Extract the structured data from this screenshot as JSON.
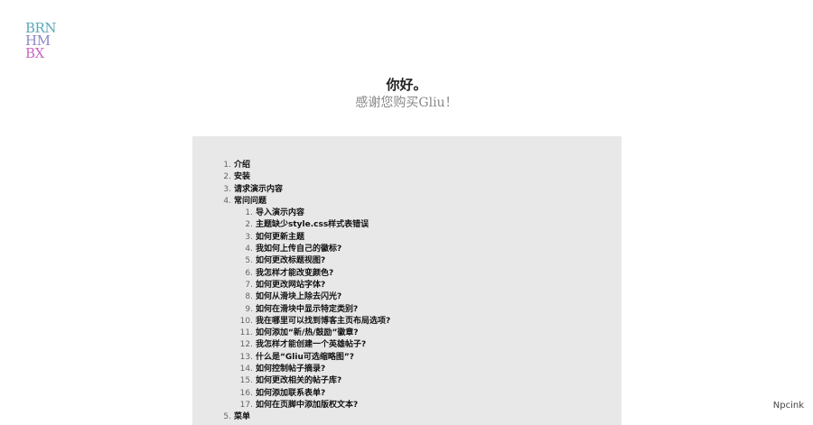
{
  "logo": {
    "line1": "BRN",
    "line2": "HM",
    "line3": "BX"
  },
  "greeting": {
    "hello": "你好。",
    "thanks": "感谢您购买Gliu！"
  },
  "toc": {
    "top": [
      {
        "num": "1.",
        "label": "介绍"
      },
      {
        "num": "2.",
        "label": "安装"
      },
      {
        "num": "3.",
        "label": "请求演示内容"
      },
      {
        "num": "4.",
        "label": "常问问题"
      }
    ],
    "faq": [
      {
        "num": "1.",
        "label": "导入演示内容"
      },
      {
        "num": "2.",
        "label": "主题缺少style.css样式表错误"
      },
      {
        "num": "3.",
        "label": "如何更新主题"
      },
      {
        "num": "4.",
        "label": "我如何上传自己的徽标?"
      },
      {
        "num": "5.",
        "label": "如何更改标题视图?"
      },
      {
        "num": "6.",
        "label": "我怎样才能改变颜色?"
      },
      {
        "num": "7.",
        "label": "如何更改网站字体?"
      },
      {
        "num": "8.",
        "label": "如何从滑块上除去闪光?"
      },
      {
        "num": "9.",
        "label": "如何在滑块中显示特定类别?"
      },
      {
        "num": "10.",
        "label": "我在哪里可以找到博客主页布局选项?"
      },
      {
        "num": "11.",
        "label": "如何添加“新/热/鼓励”徽章?"
      },
      {
        "num": "12.",
        "label": "我怎样才能创建一个英雄帖子?"
      },
      {
        "num": "13.",
        "label": "什么是“Gliu可选缩略图”?"
      },
      {
        "num": "14.",
        "label": "如何控制帖子摘录?"
      },
      {
        "num": "15.",
        "label": "如何更改相关的帖子库?"
      },
      {
        "num": "16.",
        "label": "如何添加联系表单?"
      },
      {
        "num": "17.",
        "label": "如何在页脚中添加版权文本?"
      }
    ],
    "after": [
      {
        "num": "5.",
        "label": "菜单"
      }
    ]
  },
  "credit": "Npcink"
}
